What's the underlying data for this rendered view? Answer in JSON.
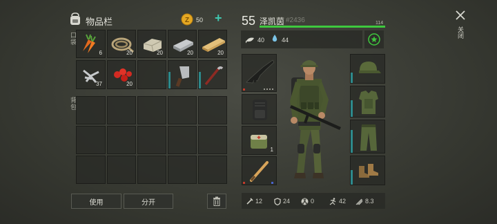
{
  "header": {
    "inventory_title": "物品栏",
    "coins": "50",
    "add_symbol": "+",
    "close_label": "关闭"
  },
  "sections": {
    "pocket_label": "口袋",
    "backpack_label": "背包"
  },
  "pocket_slots": [
    {
      "icon": "carrots-icon",
      "count": "6"
    },
    {
      "icon": "rope-icon",
      "count": "20"
    },
    {
      "icon": "stone-icon",
      "count": "20"
    },
    {
      "icon": "iron-bar-icon",
      "count": "20"
    },
    {
      "icon": "wood-plank-icon",
      "count": "20"
    },
    {
      "icon": "scrap-metal-icon",
      "count": "37"
    },
    {
      "icon": "berries-icon",
      "count": "20"
    },
    {
      "icon": "empty",
      "count": ""
    },
    {
      "icon": "cleaver-icon",
      "count": ""
    },
    {
      "icon": "crowbar-icon",
      "count": ""
    }
  ],
  "buttons": {
    "use_label": "使用",
    "split_label": "分开"
  },
  "player": {
    "level": "55",
    "name": "泽凯茵",
    "id": "#2436",
    "hp": "114",
    "food": "40",
    "water": "44"
  },
  "equipment": {
    "medkit_count": "1"
  },
  "stats": {
    "attack": "12",
    "defense": "24",
    "radiation": "0",
    "speed": "42",
    "stealth": "8.3"
  },
  "colors": {
    "accent_green": "#3ec93e",
    "bar_teal": "#2d8a8c",
    "coin_gold": "#e5a823"
  }
}
